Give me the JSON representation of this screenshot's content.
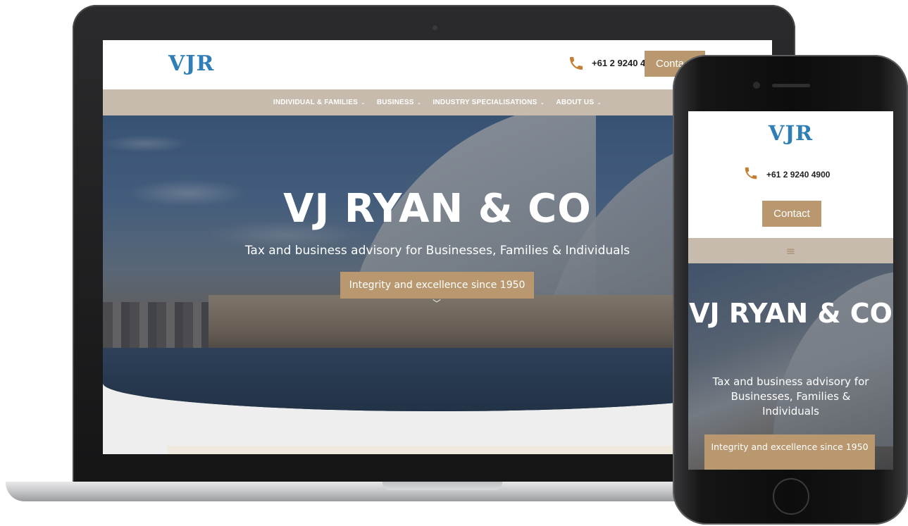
{
  "brand": {
    "logo_text": "VJR",
    "accent_color": "#b99870",
    "logo_color": "#2f7fb6",
    "nav_color": "#c7bbae"
  },
  "header": {
    "phone_icon": "phone-icon",
    "laptop_phone_number": "+61 2 9240 4",
    "laptop_contact_label": "Conta",
    "phone_number": "+61 2 9240 4900",
    "contact_label": "Contact"
  },
  "nav": {
    "items": [
      {
        "label": "INDIVIDUAL & FAMILIES"
      },
      {
        "label": "BUSINESS"
      },
      {
        "label": "INDUSTRY SPECIALISATIONS"
      },
      {
        "label": "ABOUT US"
      }
    ],
    "chevron_glyph": "⌄",
    "mobile_menu_glyph": "≡"
  },
  "hero": {
    "title": "VJ RYAN & CO",
    "subtitle": "Tax and business advisory for Businesses, Families & Individuals",
    "cta_label": "Integrity and excellence since 1950",
    "scroll_glyph": "﹀",
    "mobile_title": "VJ RYAN & CO",
    "mobile_subtitle": "Tax and business advisory for Businesses, Families & Individuals",
    "mobile_cta_label": "Integrity and excellence since 1950"
  }
}
